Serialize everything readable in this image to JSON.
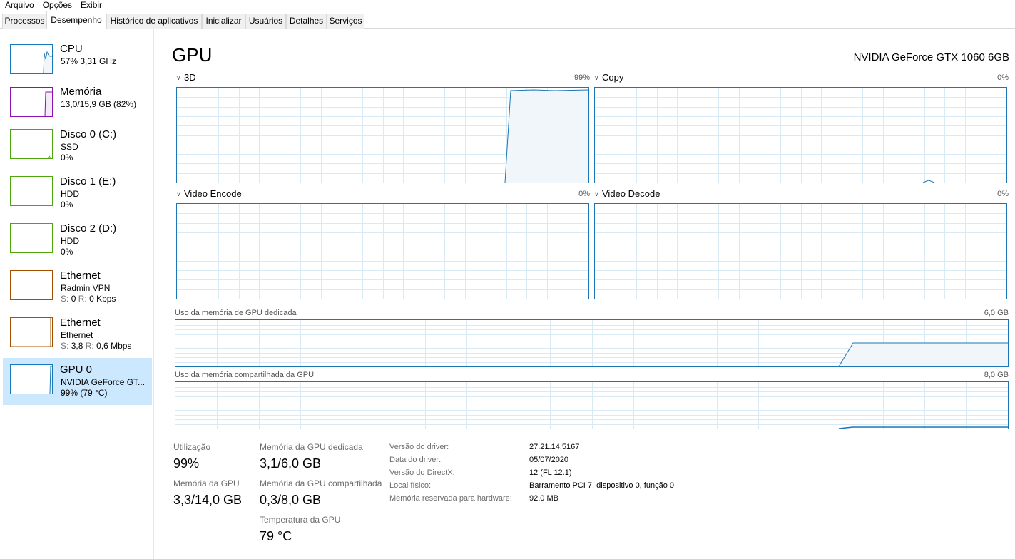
{
  "menu": [
    "Arquivo",
    "Opções",
    "Exibir"
  ],
  "tabs": [
    "Processos",
    "Desempenho",
    "Histórico de aplicativos",
    "Inicializar",
    "Usuários",
    "Detalhes",
    "Serviços"
  ],
  "active_tab": "Desempenho",
  "sidebar": [
    {
      "title": "CPU",
      "line2": "57% 3,31 GHz",
      "color": "#1779ba"
    },
    {
      "title": "Memória",
      "line2": "13,0/15,9 GB (82%)",
      "color": "#8b12ae"
    },
    {
      "title": "Disco 0 (C:)",
      "line2": "SSD",
      "line3": "0%",
      "color": "#4da60c"
    },
    {
      "title": "Disco 1 (E:)",
      "line2": "HDD",
      "line3": "0%",
      "color": "#4da60c"
    },
    {
      "title": "Disco 2 (D:)",
      "line2": "HDD",
      "line3": "0%",
      "color": "#4da60c"
    },
    {
      "title": "Ethernet",
      "line2": "Radmin VPN",
      "line3_send_label": "S:",
      "line3_send": "0",
      "line3_recv_label": "R:",
      "line3_recv": "0 Kbps",
      "color": "#a74f01"
    },
    {
      "title": "Ethernet",
      "line2": "Ethernet",
      "line3_send_label": "S:",
      "line3_send": "3,8",
      "line3_recv_label": "R:",
      "line3_recv": "0,6 Mbps",
      "color": "#a74f01"
    },
    {
      "title": "GPU 0",
      "line2": "NVIDIA GeForce GT...",
      "line3": "99% (79 °C)",
      "color": "#1779ba",
      "selected": true
    }
  ],
  "main": {
    "title": "GPU",
    "model": "NVIDIA GeForce GTX 1060 6GB",
    "engines": [
      {
        "name": "3D",
        "percent": "99%"
      },
      {
        "name": "Copy",
        "percent": "0%"
      },
      {
        "name": "Video Encode",
        "percent": "0%"
      },
      {
        "name": "Video Decode",
        "percent": "0%"
      }
    ],
    "dedicated_memory": {
      "label": "Uso da memória de GPU dedicada",
      "max": "6,0 GB"
    },
    "shared_memory": {
      "label": "Uso da memória compartilhada da GPU",
      "max": "8,0 GB"
    }
  },
  "stats": {
    "utilization_label": "Utilização",
    "utilization_value": "99%",
    "gpu_memory_label": "Memória da GPU",
    "gpu_memory_value": "3,3/14,0 GB",
    "dedicated_label": "Memória da GPU dedicada",
    "dedicated_value": "3,1/6,0 GB",
    "shared_label": "Memória da GPU compartilhada",
    "shared_value": "0,3/8,0 GB",
    "temp_label": "Temperatura da GPU",
    "temp_value": "79 °C"
  },
  "properties": [
    {
      "label": "Versão do driver:",
      "value": "27.21.14.5167"
    },
    {
      "label": "Data do driver:",
      "value": "05/07/2020"
    },
    {
      "label": "Versão do DirectX:",
      "value": "12 (FL 12.1)"
    },
    {
      "label": "Local físico:",
      "value": "Barramento PCI 7, dispositivo 0, função 0"
    },
    {
      "label": "Memória reservada para hardware:",
      "value": "92,0 MB"
    }
  ],
  "colors": {
    "gpu_line": "#1a76b5",
    "gpu_fill": "#f1f6fa",
    "grid": "#d9eaf4",
    "selected_bg": "#cce8ff"
  }
}
